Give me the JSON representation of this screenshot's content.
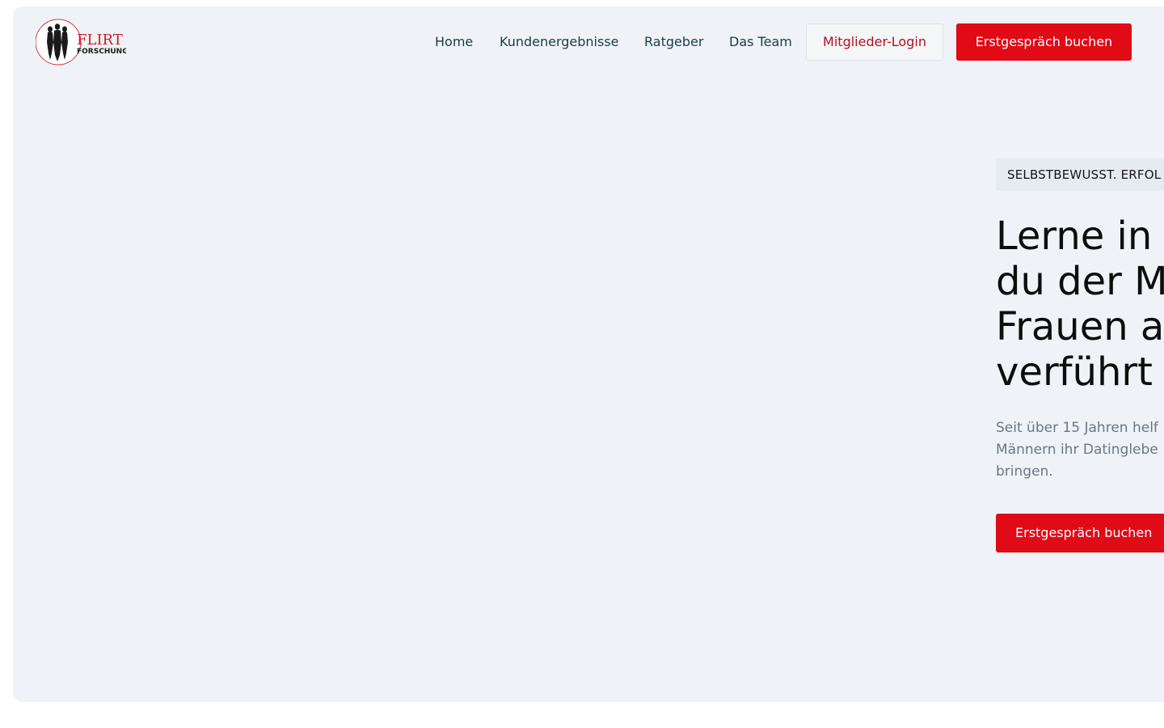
{
  "brand": {
    "logo_text_main": "FLIRT",
    "logo_text_sub": "FORSCHUNG",
    "accent_color": "#e10a17",
    "icon": "silhouettes-logo-icon"
  },
  "nav": {
    "items": [
      {
        "label": "Home"
      },
      {
        "label": "Kundenergebnisse"
      },
      {
        "label": "Ratgeber"
      },
      {
        "label": "Das Team"
      }
    ],
    "login_label": "Mitglieder-Login",
    "cta_label": "Erstgespräch buchen"
  },
  "hero": {
    "eyebrow": "SELBSTBEWUSST. ERFOL",
    "headline": "Lerne in\ndu der M\nFrauen a\nverführt",
    "subtext": "Seit über 15 Jahren helf\nMännern ihr Datinglebe\nbringen.",
    "cta_label": "Erstgespräch buchen"
  },
  "colors": {
    "background": "#eff3f7",
    "primary": "#e10a17",
    "text": "#1c3a47"
  }
}
